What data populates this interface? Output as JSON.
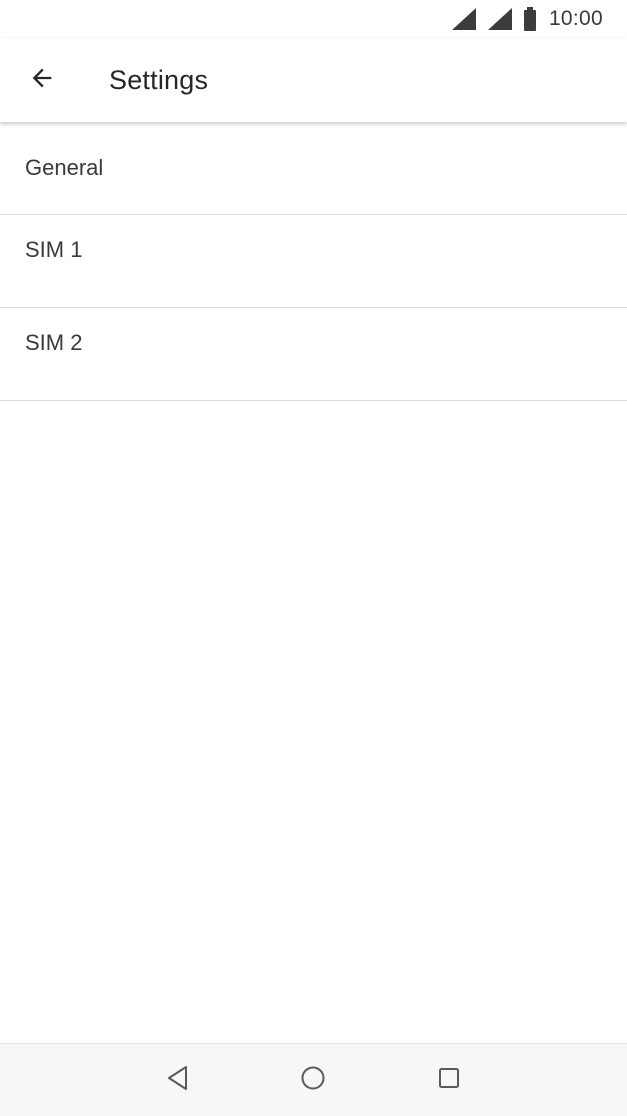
{
  "status_bar": {
    "time": "10:00",
    "icons": [
      "signal-icon",
      "signal-icon",
      "battery-icon"
    ]
  },
  "app_bar": {
    "back_icon": "arrow-left-icon",
    "title": "Settings"
  },
  "settings": {
    "items": [
      {
        "label": "General"
      },
      {
        "label": "SIM 1"
      },
      {
        "label": "SIM 2"
      }
    ]
  },
  "nav_bar": {
    "buttons": [
      "back-triangle-icon",
      "home-circle-icon",
      "recents-square-icon"
    ]
  },
  "colors": {
    "background": "#ffffff",
    "text": "#3a3a3a",
    "divider": "#dcdcdc",
    "nav_background": "#f7f7f7"
  }
}
